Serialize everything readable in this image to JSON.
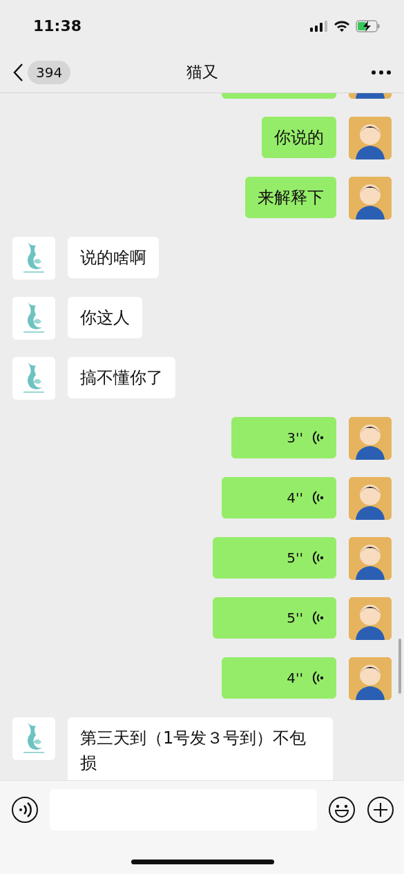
{
  "status_bar": {
    "time": "11:38"
  },
  "nav": {
    "unread_count": "394",
    "title": "猫又"
  },
  "messages": [
    {
      "kind": "partial",
      "outgoing": true
    },
    {
      "kind": "text",
      "outgoing": true,
      "text": "你说的"
    },
    {
      "kind": "text",
      "outgoing": true,
      "text": "来解释下"
    },
    {
      "kind": "text",
      "outgoing": false,
      "text": "说的啥啊"
    },
    {
      "kind": "text",
      "outgoing": false,
      "text": "你这人"
    },
    {
      "kind": "text",
      "outgoing": false,
      "text": "搞不懂你了"
    },
    {
      "kind": "voice",
      "outgoing": true,
      "duration": "3''"
    },
    {
      "kind": "voice",
      "outgoing": true,
      "duration": "4''"
    },
    {
      "kind": "voice",
      "outgoing": true,
      "duration": "5''"
    },
    {
      "kind": "voice",
      "outgoing": true,
      "duration": "5''"
    },
    {
      "kind": "voice",
      "outgoing": true,
      "duration": "4''"
    },
    {
      "kind": "text",
      "outgoing": false,
      "text": "第三天到（1号发３号到）不包损"
    }
  ]
}
